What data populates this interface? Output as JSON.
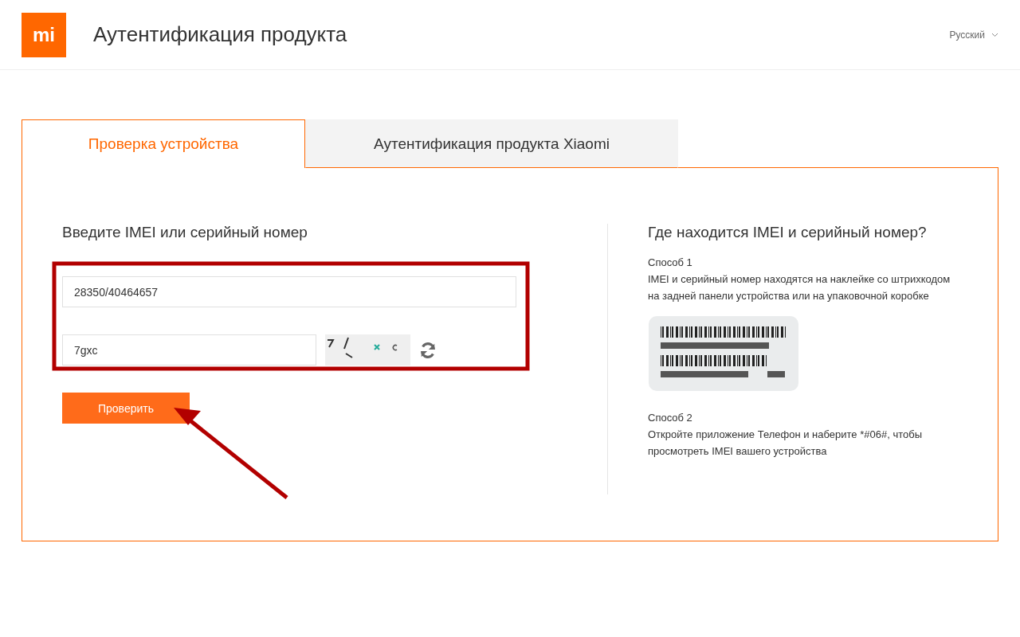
{
  "header": {
    "logo": "mi",
    "title": "Аутентификация продукта",
    "language": "Русский"
  },
  "tabs": [
    {
      "label": "Проверка устройства",
      "selected": true
    },
    {
      "label": "Аутентификация продукта Xiaomi",
      "selected": false
    }
  ],
  "form": {
    "heading": "Введите IMEI или серийный номер",
    "imei_field": {
      "value": "28350/40464657"
    },
    "captcha_field": {
      "value": "7gxc"
    },
    "submit": "Проверить"
  },
  "help": {
    "heading": "Где находится IMEI и серийный номер?",
    "method_1": {
      "title": "Способ 1",
      "text": "IMEI и серийный номер находятся на наклейке со штрихкодом на задней панели устройства или на упаковочной коробке"
    },
    "method_2": {
      "title": "Способ 2",
      "text": "Откройте приложение Телефон и наберите *#06#, чтобы просмотреть IMEI вашего устройства"
    }
  }
}
